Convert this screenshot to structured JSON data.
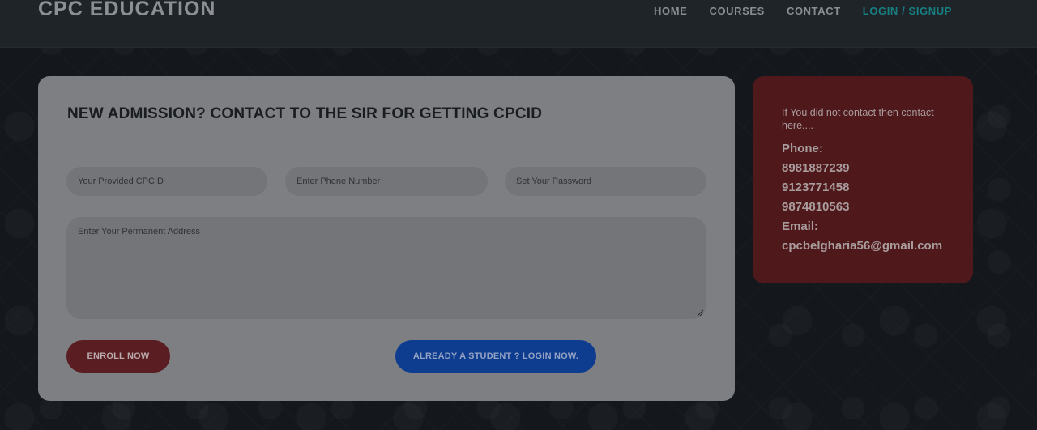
{
  "navbar": {
    "brand": "CPC EDUCATION",
    "links": [
      {
        "label": "HOME"
      },
      {
        "label": "COURSES"
      },
      {
        "label": "CONTACT"
      },
      {
        "label": "LOGIN / SIGNUP"
      }
    ],
    "active_color": "#177f80"
  },
  "form": {
    "title": "NEW ADMISSION? CONTACT TO THE SIR FOR GETTING CPCID",
    "cpcid_placeholder": "Your Provided CPCID",
    "phone_placeholder": "Enter Phone Number",
    "password_placeholder": "Set Your Password",
    "address_placeholder": "Enter Your Permanent Address",
    "enroll_label": "ENROLL NOW",
    "login_label": "ALREADY A STUDENT ? LOGIN NOW."
  },
  "contact": {
    "note": "If You did not contact then contact here....",
    "phone_label": "Phone:",
    "phones": [
      "8981887239",
      "9123771458",
      "9874810563"
    ],
    "email_label": "Email:",
    "email": "cpcbelgharia56@gmail.com"
  },
  "colors": {
    "enroll_button": "#591d22",
    "login_button": "#0e3c8e",
    "contact_card": "#4f191c",
    "overlay_dim": "#14181d"
  },
  "icons": [
    "textarea-resize-grip-icon"
  ]
}
